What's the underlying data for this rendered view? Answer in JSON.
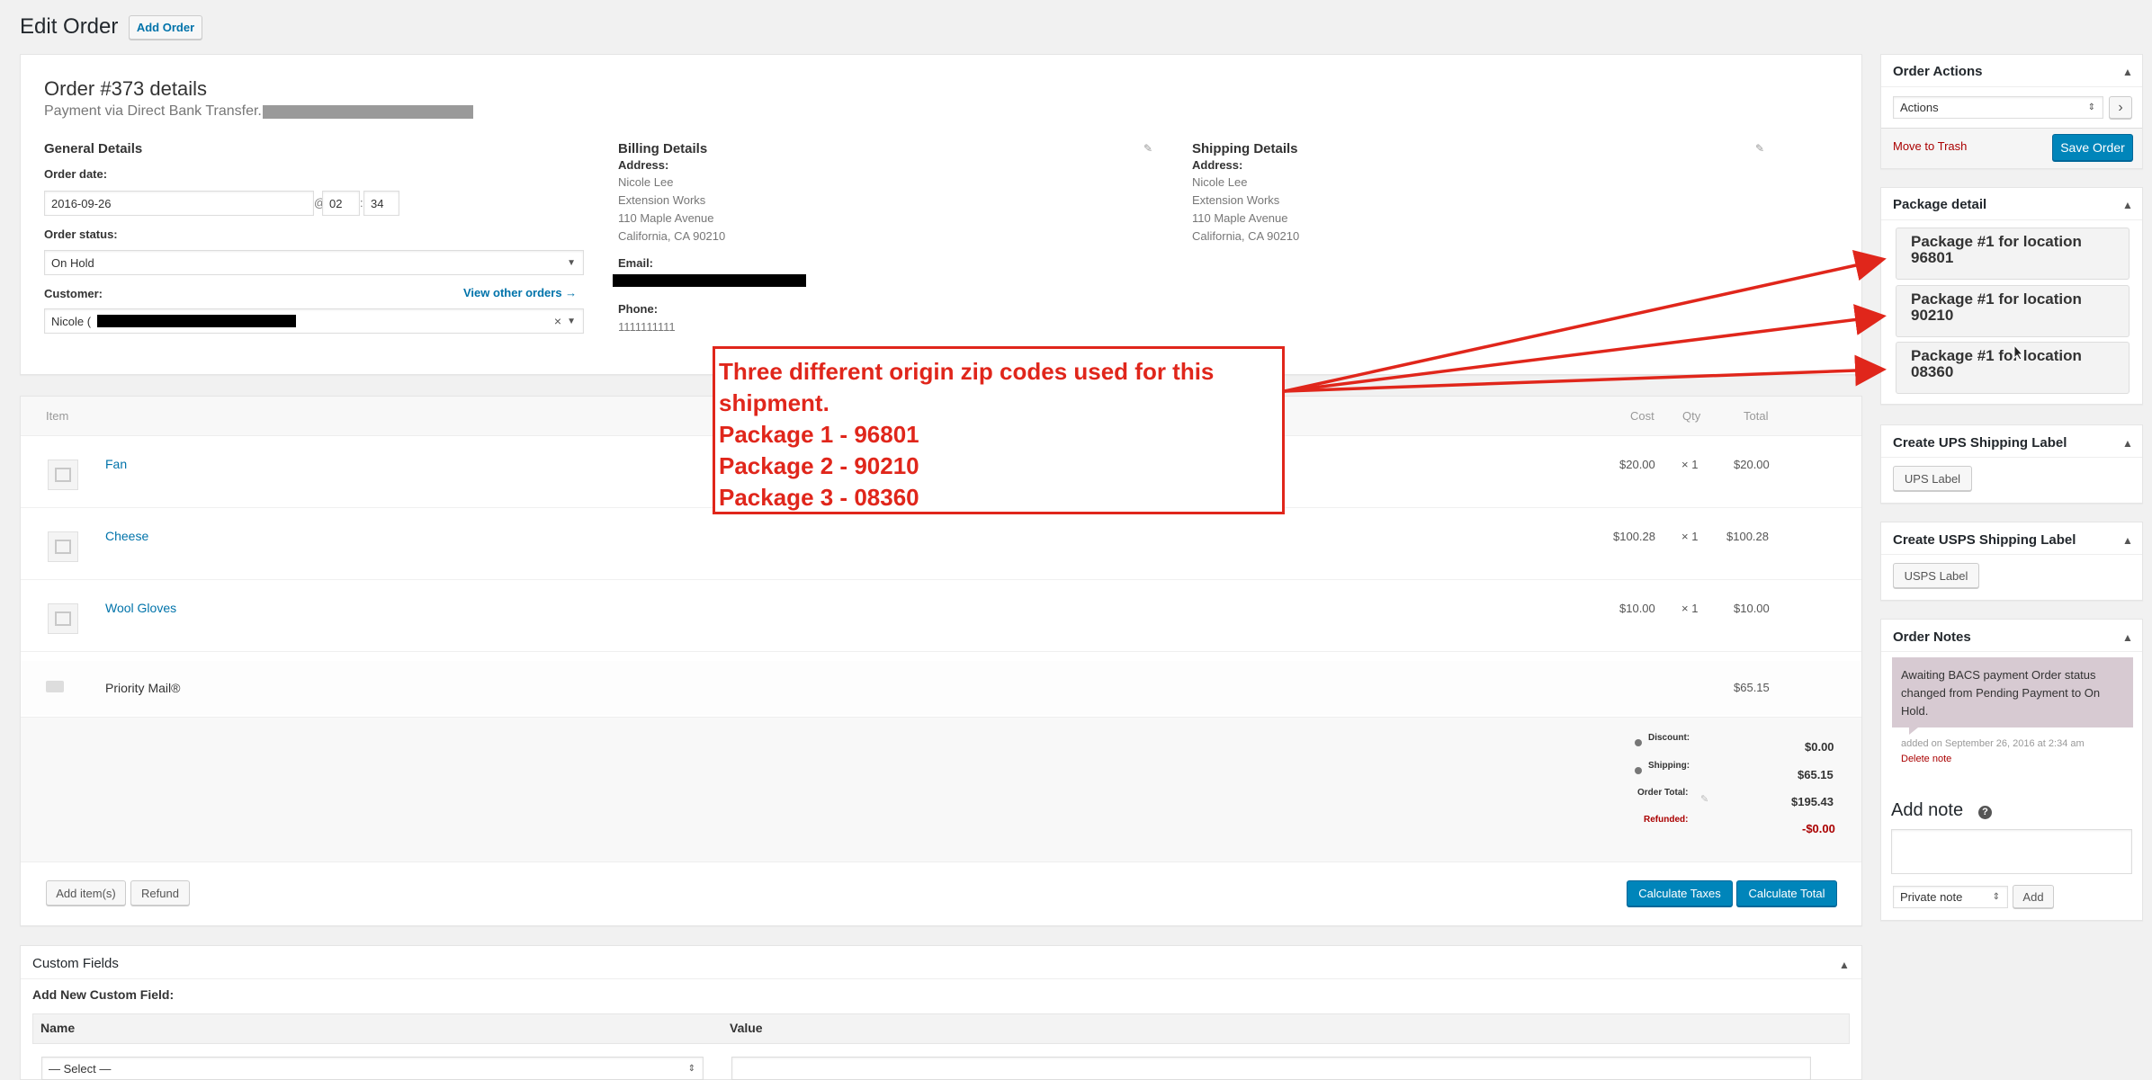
{
  "page": {
    "title": "Edit Order",
    "add_order_button": "Add Order"
  },
  "order": {
    "heading": "Order #373 details",
    "payment_text": "Payment via Direct Bank Transfer.",
    "general": {
      "title": "General Details",
      "order_date_label": "Order date:",
      "date_value": "2016-09-26",
      "at": "@",
      "hour": "02",
      "colon": ":",
      "minute": "34",
      "status_label": "Order status:",
      "status_value": "On Hold",
      "customer_label": "Customer:",
      "view_other_orders": "View other orders →",
      "customer_value": "Nicole (",
      "clear_symbol": "×"
    },
    "billing": {
      "title": "Billing Details",
      "address_label": "Address:",
      "address_lines": [
        "Nicole Lee",
        "Extension Works",
        "110 Maple Avenue",
        "California, CA 90210"
      ],
      "email_label": "Email:",
      "phone_label": "Phone:",
      "phone_value": "1111111111"
    },
    "shipping": {
      "title": "Shipping Details",
      "address_label": "Address:",
      "address_lines": [
        "Nicole Lee",
        "Extension Works",
        "110 Maple Avenue",
        "California, CA 90210"
      ]
    }
  },
  "items": {
    "headers": {
      "item": "Item",
      "cost": "Cost",
      "qty": "Qty",
      "total": "Total"
    },
    "rows": [
      {
        "name": "Fan",
        "cost": "$20.00",
        "qty": "× 1",
        "total": "$20.00"
      },
      {
        "name": "Cheese",
        "cost": "$100.28",
        "qty": "× 1",
        "total": "$100.28"
      },
      {
        "name": "Wool Gloves",
        "cost": "$10.00",
        "qty": "× 1",
        "total": "$10.00"
      }
    ],
    "shipping_row": {
      "name": "Priority Mail®",
      "total": "$65.15"
    },
    "totals": {
      "discount_label": "Discount:",
      "discount_value": "$0.00",
      "shipping_label": "Shipping:",
      "shipping_value": "$65.15",
      "order_total_label": "Order Total:",
      "order_total_value": "$195.43",
      "refunded_label": "Refunded:",
      "refunded_value": "-$0.00"
    },
    "buttons": {
      "add_items": "Add item(s)",
      "refund": "Refund",
      "calculate_taxes": "Calculate Taxes",
      "calculate_total": "Calculate Total"
    }
  },
  "annotation": {
    "lines": [
      "Three different origin zip codes used for this",
      "shipment.",
      "Package 1 - 96801",
      "Package 2 - 90210",
      "Package 3 - 08360"
    ]
  },
  "custom_fields": {
    "title": "Custom Fields",
    "add_new_label": "Add New Custom Field:",
    "name_header": "Name",
    "value_header": "Value",
    "select_placeholder": "— Select —"
  },
  "sidebar": {
    "order_actions": {
      "title": "Order Actions",
      "select_value": "Actions",
      "go_symbol": "›",
      "move_to_trash": "Move to Trash",
      "save_order": "Save Order"
    },
    "package_detail": {
      "title": "Package detail",
      "packages": [
        {
          "line1": "Package #1 for location",
          "line2": "96801"
        },
        {
          "line1": "Package #1 for location",
          "line2": "90210"
        },
        {
          "line1": "Package #1 for location",
          "line2": "08360"
        }
      ]
    },
    "ups": {
      "title": "Create UPS Shipping Label",
      "button": "UPS Label"
    },
    "usps": {
      "title": "Create USPS Shipping Label",
      "button": "USPS Label"
    },
    "order_notes": {
      "title": "Order Notes",
      "note_text": "Awaiting BACS payment Order status changed from Pending Payment to On Hold.",
      "note_meta": "added on September 26, 2016 at 2:34 am",
      "delete_note": "Delete note",
      "add_note_title": "Add note",
      "help_symbol": "?",
      "note_type": "Private note",
      "add_button": "Add"
    }
  },
  "colors": {
    "primary": "#0085ba",
    "annotation_red": "#e0261b",
    "note_bg": "#d7cad2",
    "link": "#0073aa",
    "trash_red": "#a00"
  }
}
